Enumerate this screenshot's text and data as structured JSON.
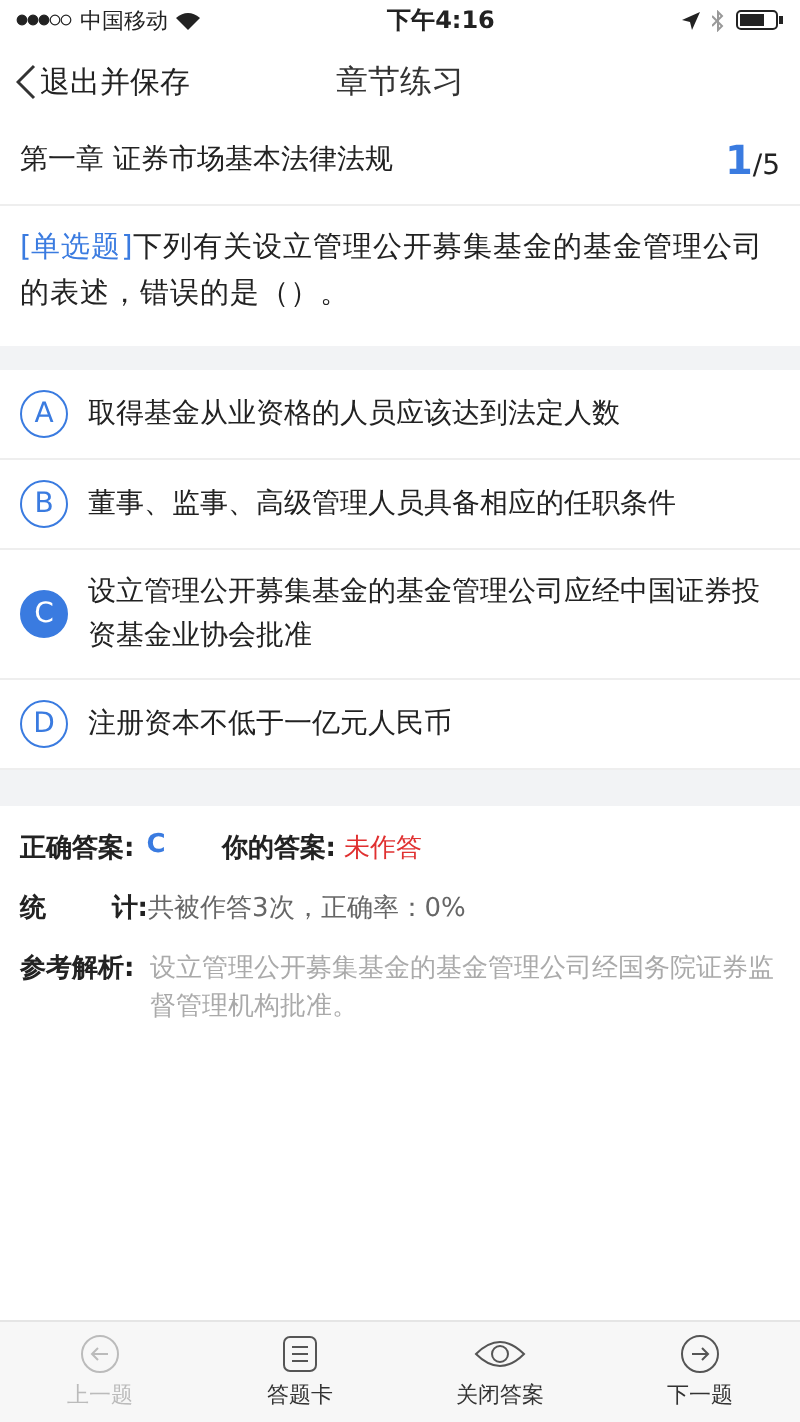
{
  "status_bar": {
    "carrier": "中国移动",
    "time": "下午4:16"
  },
  "nav": {
    "back": "退出并保存",
    "title": "章节练习"
  },
  "chapter": {
    "title": "第一章 证券市场基本法律法规",
    "current": "1",
    "total": "/5"
  },
  "question": {
    "type": "[单选题]",
    "text": "下列有关设立管理公开募集基金的基金管理公司的表述，错误的是（）。"
  },
  "options": [
    {
      "letter": "A",
      "text": "取得基金从业资格的人员应该达到法定人数",
      "selected": false
    },
    {
      "letter": "B",
      "text": "董事、监事、高级管理人员具备相应的任职条件",
      "selected": false
    },
    {
      "letter": "C",
      "text": "设立管理公开募集基金的基金管理公司应经中国证券投资基金业协会批准",
      "selected": true
    },
    {
      "letter": "D",
      "text": "注册资本不低于一亿元人民币",
      "selected": false
    }
  ],
  "answer": {
    "correct_label": "正确答案:",
    "correct": "C",
    "yours_label": "你的答案:",
    "yours": "未作答",
    "stats_label_1": "统",
    "stats_label_2": "计:",
    "stats": "共被作答3次，正确率：0%",
    "analysis_label": "参考解析:",
    "analysis": "设立管理公开募集基金的基金管理公司经国务院证券监督管理机构批准。"
  },
  "toolbar": [
    {
      "kind": "prev",
      "label": "上一题",
      "disabled": true
    },
    {
      "kind": "card",
      "label": "答题卡",
      "disabled": false
    },
    {
      "kind": "eye",
      "label": "关闭答案",
      "disabled": false
    },
    {
      "kind": "next",
      "label": "下一题",
      "disabled": false
    }
  ]
}
